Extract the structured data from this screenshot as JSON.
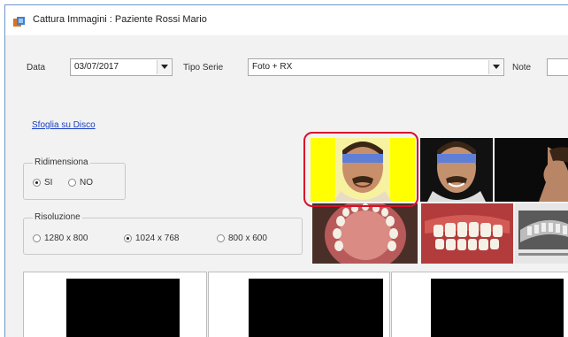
{
  "window": {
    "title": "Cattura Immagini : Paziente Rossi Mario",
    "accent_color": "#6e98c8"
  },
  "toolbar": {
    "date_label": "Data",
    "date_value": "03/07/2017",
    "series_label": "Tipo Serie",
    "series_value": "Foto + RX",
    "note_label": "Note",
    "note_value": ""
  },
  "browse_link": "Sfoglia su Disco",
  "resize_group": {
    "legend": "Ridimensiona",
    "options": [
      {
        "label": "SI",
        "selected": true
      },
      {
        "label": "NO",
        "selected": false
      }
    ]
  },
  "resolution_group": {
    "legend": "Risoluzione",
    "options": [
      {
        "label": "1280 x 800",
        "selected": false
      },
      {
        "label": "1024 x 768",
        "selected": true
      },
      {
        "label": "800 x 600",
        "selected": false
      }
    ]
  },
  "thumbnails": [
    {
      "kind": "face-frontal-yellow-bg",
      "selected": true
    },
    {
      "kind": "face-smile-dark-bg",
      "selected": false
    },
    {
      "kind": "face-profile-dark-bg",
      "selected": false
    },
    {
      "kind": "intraoral-upper-arch",
      "selected": false
    },
    {
      "kind": "intraoral-frontal-teeth",
      "selected": false
    },
    {
      "kind": "xray-panoramic",
      "selected": false
    }
  ],
  "colors": {
    "selection_ring": "#d8102a",
    "thumb_yellow": "#ffff00",
    "link": "#1a3fbf"
  }
}
